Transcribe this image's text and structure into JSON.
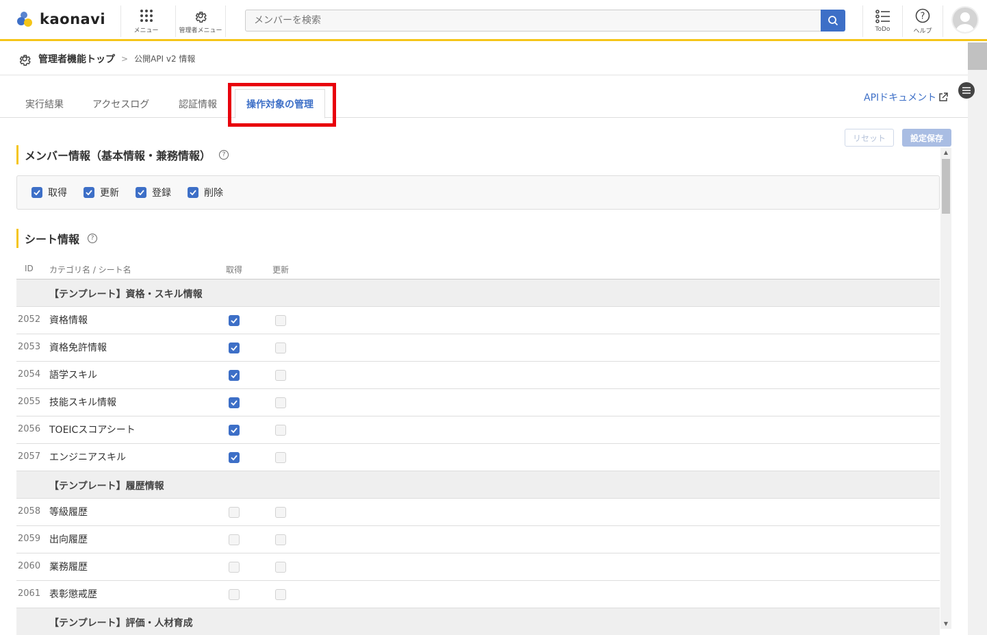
{
  "app": {
    "logo_text": "kaonavi"
  },
  "header": {
    "menu_label": "メニュー",
    "admin_menu_label": "管理者メニュー",
    "search_placeholder": "メンバーを検索",
    "todo_label": "ToDo",
    "help_label": "ヘルプ"
  },
  "breadcrumb": {
    "top": "管理者機能トップ",
    "current": "公開API v2 情報"
  },
  "tabs": [
    {
      "label": "実行結果"
    },
    {
      "label": "アクセスログ"
    },
    {
      "label": "認証情報"
    },
    {
      "label": "操作対象の管理",
      "active": true
    }
  ],
  "api_doc_link": "APIドキュメント",
  "buttons": {
    "reset": "リセット",
    "save": "設定保存"
  },
  "member_section": {
    "title": "メンバー情報（基本情報・兼務情報）",
    "options": [
      {
        "label": "取得",
        "checked": true
      },
      {
        "label": "更新",
        "checked": true
      },
      {
        "label": "登録",
        "checked": true
      },
      {
        "label": "削除",
        "checked": true
      }
    ]
  },
  "sheet_section": {
    "title": "シート情報",
    "columns": {
      "id": "ID",
      "name": "カテゴリ名 / シート名",
      "get": "取得",
      "update": "更新"
    },
    "groups": [
      {
        "category": "【テンプレート】資格・スキル情報",
        "rows": [
          {
            "id": "2052",
            "name": "資格情報",
            "get": true,
            "update": false
          },
          {
            "id": "2053",
            "name": "資格免許情報",
            "get": true,
            "update": false
          },
          {
            "id": "2054",
            "name": "語学スキル",
            "get": true,
            "update": false
          },
          {
            "id": "2055",
            "name": "技能スキル情報",
            "get": true,
            "update": false
          },
          {
            "id": "2056",
            "name": "TOEICスコアシート",
            "get": true,
            "update": false
          },
          {
            "id": "2057",
            "name": "エンジニアスキル",
            "get": true,
            "update": false
          }
        ]
      },
      {
        "category": "【テンプレート】履歴情報",
        "rows": [
          {
            "id": "2058",
            "name": "等級履歴",
            "get": false,
            "update": false
          },
          {
            "id": "2059",
            "name": "出向履歴",
            "get": false,
            "update": false
          },
          {
            "id": "2060",
            "name": "業務履歴",
            "get": false,
            "update": false
          },
          {
            "id": "2061",
            "name": "表彰懲戒歴",
            "get": false,
            "update": false
          }
        ]
      },
      {
        "category": "【テンプレート】評価・人材育成",
        "rows": []
      }
    ]
  },
  "colors": {
    "accent": "#3d6fc7",
    "brand_yellow": "#f5c518",
    "highlight": "#e8000b"
  }
}
